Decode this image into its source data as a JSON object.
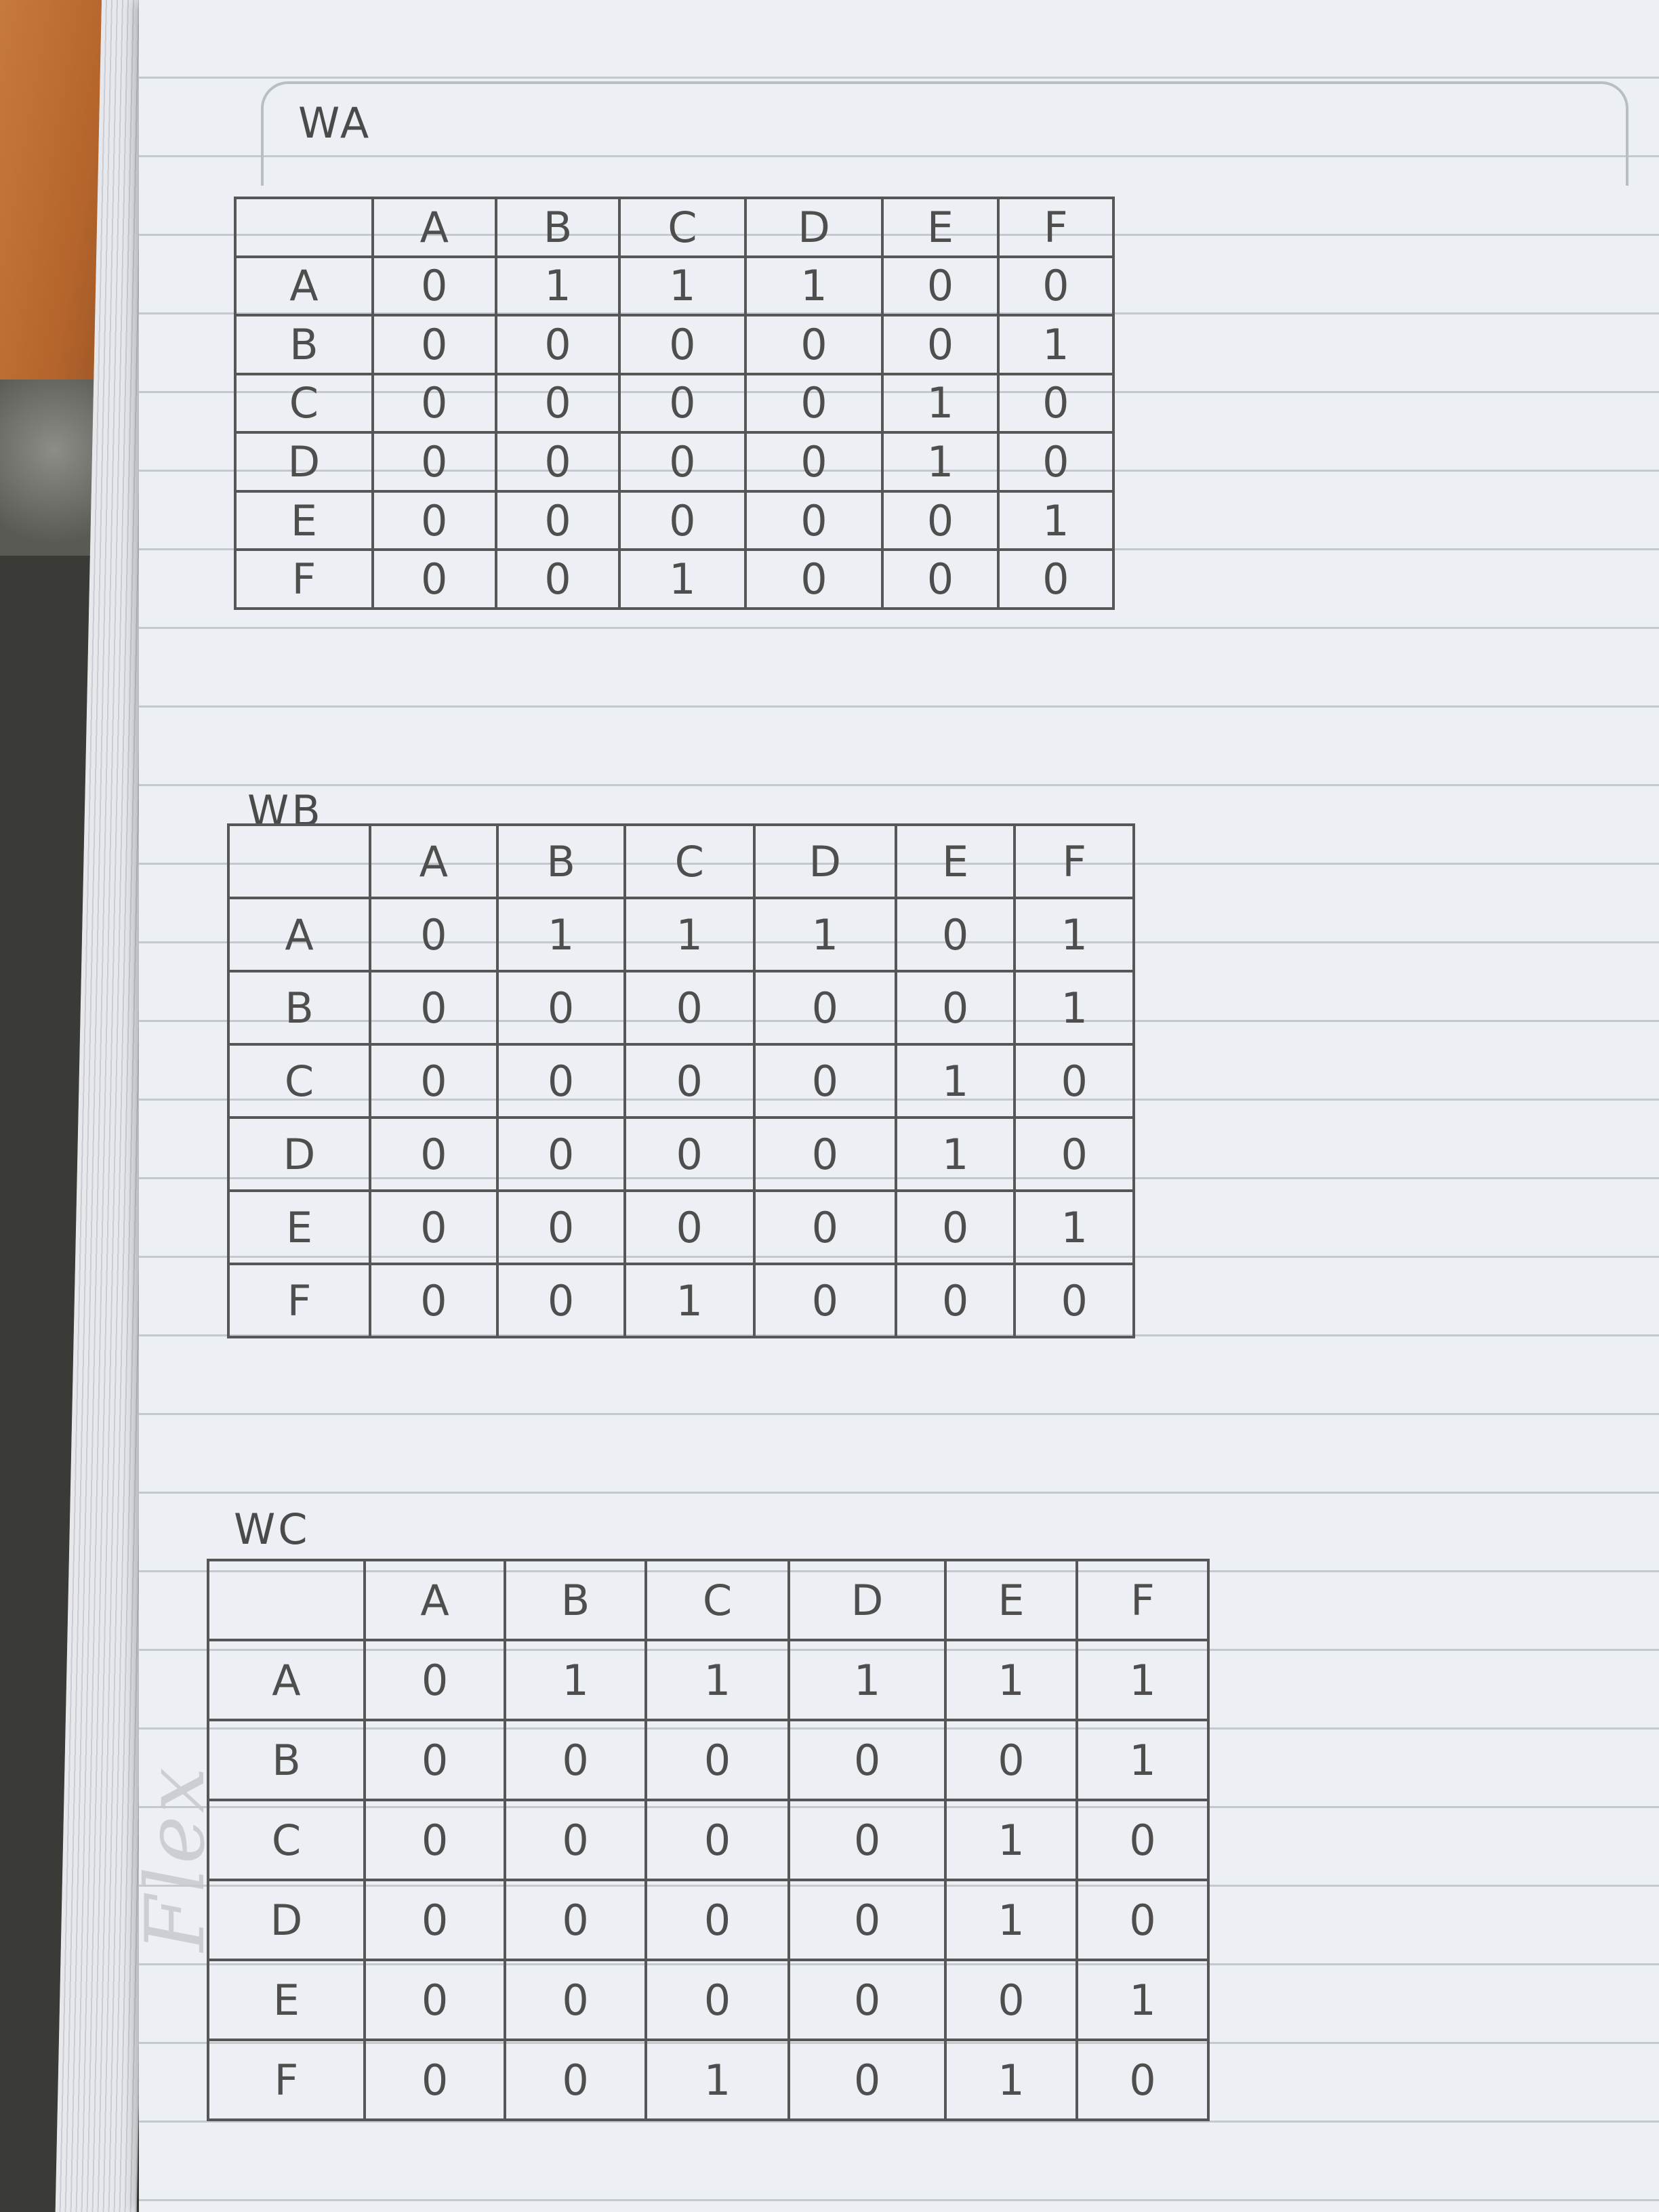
{
  "watermark": "Flex",
  "tables": [
    {
      "title": "WA",
      "columns": [
        "A",
        "B",
        "C",
        "D",
        "E",
        "F"
      ],
      "rows": [
        {
          "label": "A",
          "cells": [
            "0",
            "1",
            "1",
            "1",
            "0",
            "0"
          ]
        },
        {
          "label": "B",
          "cells": [
            "0",
            "0",
            "0",
            "0",
            "0",
            "1"
          ]
        },
        {
          "label": "C",
          "cells": [
            "0",
            "0",
            "0",
            "0",
            "1",
            "0"
          ]
        },
        {
          "label": "D",
          "cells": [
            "0",
            "0",
            "0",
            "0",
            "1",
            "0"
          ]
        },
        {
          "label": "E",
          "cells": [
            "0",
            "0",
            "0",
            "0",
            "0",
            "1"
          ]
        },
        {
          "label": "F",
          "cells": [
            "0",
            "0",
            "1",
            "0",
            "0",
            "0"
          ]
        }
      ]
    },
    {
      "title": "WB",
      "columns": [
        "A",
        "B",
        "C",
        "D",
        "E",
        "F"
      ],
      "rows": [
        {
          "label": "A",
          "cells": [
            "0",
            "1",
            "1",
            "1",
            "0",
            "1"
          ]
        },
        {
          "label": "B",
          "cells": [
            "0",
            "0",
            "0",
            "0",
            "0",
            "1"
          ]
        },
        {
          "label": "C",
          "cells": [
            "0",
            "0",
            "0",
            "0",
            "1",
            "0"
          ]
        },
        {
          "label": "D",
          "cells": [
            "0",
            "0",
            "0",
            "0",
            "1",
            "0"
          ]
        },
        {
          "label": "E",
          "cells": [
            "0",
            "0",
            "0",
            "0",
            "0",
            "1"
          ]
        },
        {
          "label": "F",
          "cells": [
            "0",
            "0",
            "1",
            "0",
            "0",
            "0"
          ]
        }
      ]
    },
    {
      "title": "WC",
      "columns": [
        "A",
        "B",
        "C",
        "D",
        "E",
        "F"
      ],
      "rows": [
        {
          "label": "A",
          "cells": [
            "0",
            "1",
            "1",
            "1",
            "1",
            "1"
          ]
        },
        {
          "label": "B",
          "cells": [
            "0",
            "0",
            "0",
            "0",
            "0",
            "1"
          ]
        },
        {
          "label": "C",
          "cells": [
            "0",
            "0",
            "0",
            "0",
            "1",
            "0"
          ]
        },
        {
          "label": "D",
          "cells": [
            "0",
            "0",
            "0",
            "0",
            "1",
            "0"
          ]
        },
        {
          "label": "E",
          "cells": [
            "0",
            "0",
            "0",
            "0",
            "0",
            "1"
          ]
        },
        {
          "label": "F",
          "cells": [
            "0",
            "0",
            "1",
            "0",
            "1",
            "0"
          ]
        }
      ]
    }
  ]
}
